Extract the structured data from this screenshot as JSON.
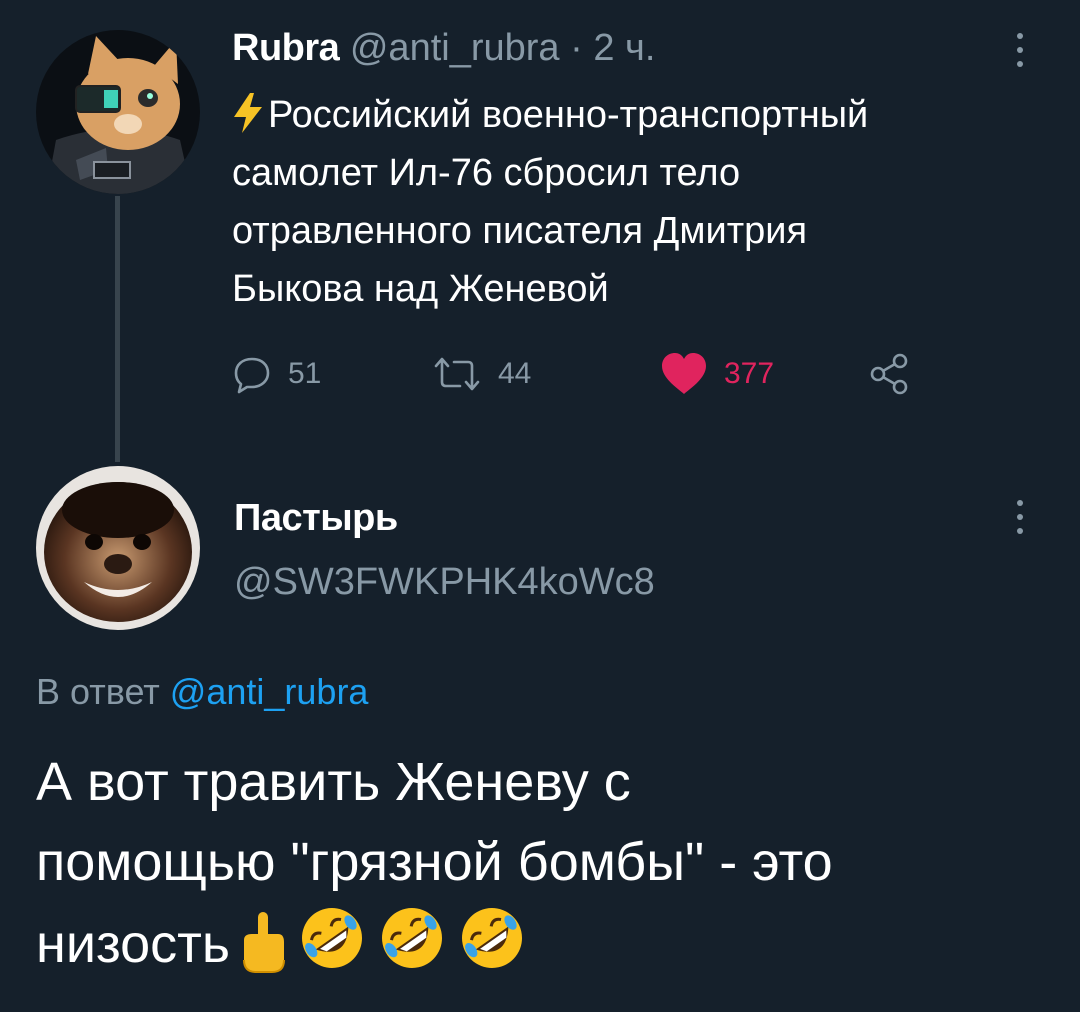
{
  "tweet": {
    "author_name": "Rubra",
    "handle": "@anti_rubra",
    "time_separator": "·",
    "time": "2 ч.",
    "lines": [
      "Российский военно-транспортный",
      "самолет Ил-76 сбросил тело",
      "отравленного писателя Дмитрия",
      "Быкова над Женевой"
    ],
    "lead_icon": "lightning-bolt-emoji",
    "replies": "51",
    "retweets": "44",
    "likes": "377",
    "liked": true,
    "colors": {
      "like": "#e0245e",
      "muted": "#8899a6",
      "background": "#15202b",
      "link": "#1da1f2"
    }
  },
  "reply": {
    "author_name": "Пастырь",
    "handle": "@SW3FWKPHK4koWc8",
    "reply_to_prefix": "В ответ",
    "reply_to_handle": "@anti_rubra",
    "lines": [
      "А вот травить Женеву с",
      "помощью \"грязной бомбы\" - это",
      "низость"
    ],
    "trailing_emojis": [
      "index-pointing-up-emoji",
      "rolling-on-floor-laughing-emoji",
      "rolling-on-floor-laughing-emoji",
      "rolling-on-floor-laughing-emoji"
    ]
  }
}
